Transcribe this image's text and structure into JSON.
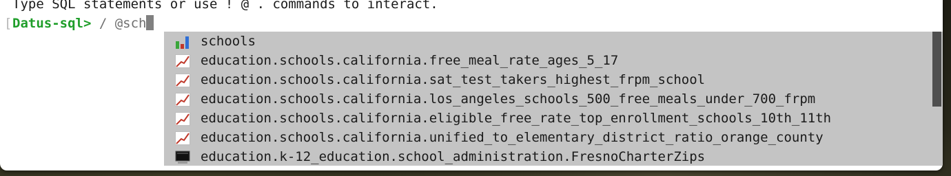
{
  "terminal": {
    "intro_text": "Type SQL statements or use ! @ . commands to interact.",
    "bracket": "[",
    "prompt": "Datus-sql>",
    "separator": " / ",
    "typed_input": "@sch"
  },
  "completion_menu": {
    "items": [
      {
        "label": "schools",
        "icon": "bar-chart-icon"
      },
      {
        "label": "education.schools.california.free_meal_rate_ages_5_17",
        "icon": "line-chart-icon"
      },
      {
        "label": "education.schools.california.sat_test_takers_highest_frpm_school",
        "icon": "line-chart-icon"
      },
      {
        "label": "education.schools.california.los_angeles_schools_500_free_meals_under_700_frpm",
        "icon": "line-chart-icon"
      },
      {
        "label": "education.schools.california.eligible_free_rate_top_enrollment_schools_10th_11th",
        "icon": "line-chart-icon"
      },
      {
        "label": "education.schools.california.unified_to_elementary_district_ratio_orange_county",
        "icon": "line-chart-icon"
      },
      {
        "label": "education.k-12_education.school_administration.FresnoCharterZips",
        "icon": "monitor-icon"
      }
    ],
    "scroll_position": 0.0,
    "visible_fraction": 0.56
  },
  "colors": {
    "prompt_green": "#1f9e2a",
    "menu_background": "#c4c4c4",
    "scroll_thumb": "#4f4f4f",
    "chart_red": "#c0392b",
    "bar_blue": "#2f6fd6",
    "bar_green": "#3aa63a"
  }
}
